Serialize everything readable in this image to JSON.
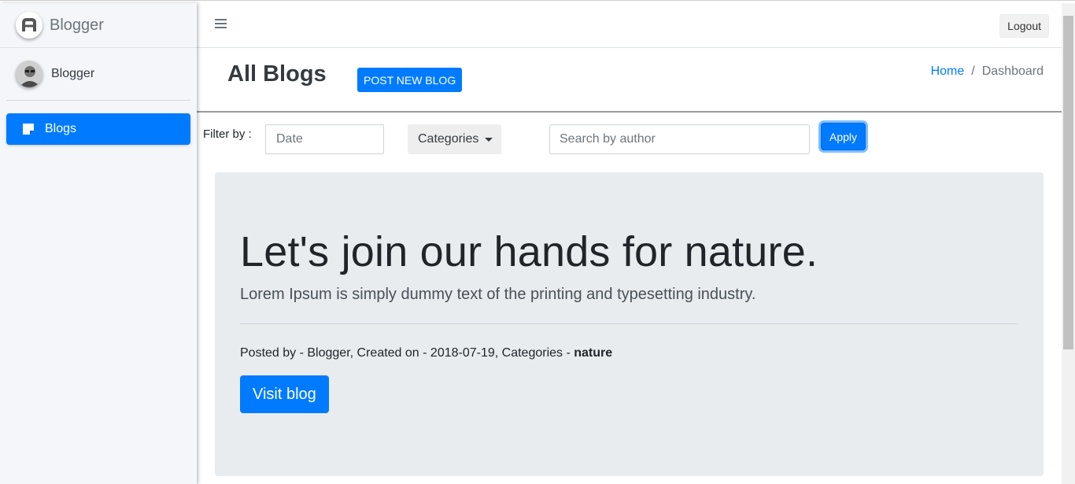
{
  "brand": {
    "name": "Blogger"
  },
  "user": {
    "name": "Blogger"
  },
  "sidebar": {
    "items": [
      {
        "label": "Blogs",
        "active": true
      }
    ]
  },
  "navbar": {
    "logout_label": "Logout"
  },
  "header": {
    "title": "All Blogs",
    "post_button_label": "POST NEW BLOG",
    "breadcrumb": {
      "home": "Home",
      "separator": "/",
      "current": "Dashboard"
    }
  },
  "filter": {
    "label": "Filter by :",
    "date_placeholder": "Date",
    "categories_label": "Categories",
    "search_placeholder": "Search by author",
    "apply_label": "Apply"
  },
  "blog": {
    "title": "Let's join our hands for nature.",
    "lead": "Lorem Ipsum is simply dummy text of the printing and typesetting industry.",
    "meta_prefix": "Posted by - Blogger, Created on - 2018-07-19, Categories - ",
    "category": "nature",
    "visit_label": "Visit blog"
  },
  "colors": {
    "primary": "#007bff",
    "sidebar_bg": "#f4f6f9",
    "card_bg": "#e9ecef"
  },
  "icons": [
    "brand-logo-icon",
    "avatar",
    "blog-note-icon",
    "hamburger-icon",
    "caret-down-icon"
  ]
}
